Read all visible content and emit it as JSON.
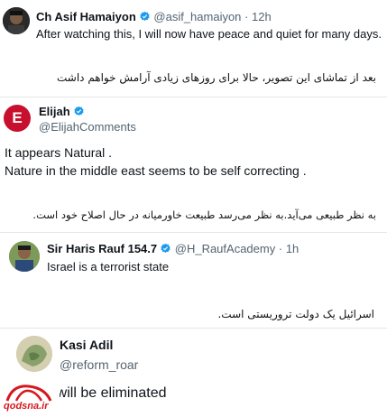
{
  "tweets": [
    {
      "name": "Ch Asif Hamaiyon",
      "handle": "@asif_hamaiyon",
      "separator": "·",
      "time": "12h",
      "text": "After watching this, I will now have peace and quiet for many days.",
      "translation": "بعد از تماشای این تصویر، حالا برای روزهای زیادی آرامش خواهم داشت"
    },
    {
      "name": "Elijah",
      "handle": "@ElijahComments",
      "avatar_letter": "E",
      "text_line1": "It appears Natural .",
      "text_line2": "Nature in the middle east seems to be self correcting .",
      "translation": "به نظر طبیعی می‌آید.به نظر می‌رسد طبیعت خاورمیانه در حال اصلاح خود است."
    },
    {
      "name": "Sir Haris Rauf 154.7",
      "handle": "@H_RaufAcademy",
      "separator": "·",
      "time": "1h",
      "text": "Israel is a terrorist state",
      "translation": "اسرائیل یک دولت تروریستی است."
    },
    {
      "name": "Kasi Adil",
      "handle": "@reform_roar",
      "text": "israel will be eliminated"
    }
  ],
  "watermark": "qodsna.ir",
  "colors": {
    "verified": "#1d9bf0",
    "elijah_avatar": "#c8102e",
    "watermark": "#d6171f"
  },
  "icons": [
    "verified-badge-icon",
    "avatar-image",
    "watermark-logo"
  ]
}
